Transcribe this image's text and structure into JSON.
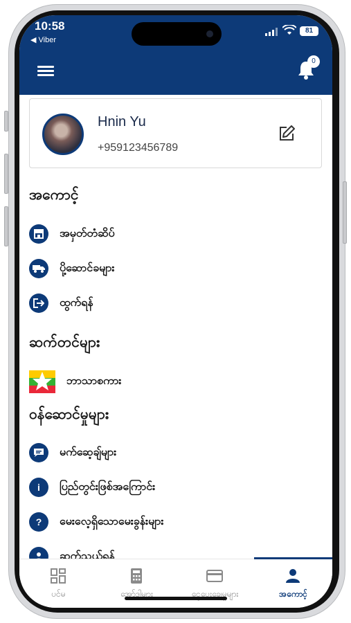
{
  "status_bar": {
    "time": "10:58",
    "back_app": "◀ Viber",
    "battery": "81"
  },
  "header": {
    "menu_icon": "hamburger-icon",
    "notification_icon": "bell-icon",
    "notification_count": "0"
  },
  "profile": {
    "name": "Hnin Yu",
    "phone": "+959123456789",
    "edit_icon": "edit-pencil-icon"
  },
  "sections": {
    "account": {
      "title": "အကောင့်",
      "items": [
        {
          "label": "အမှတ်တံဆိပ်",
          "icon": "store-icon"
        },
        {
          "label": "ပို့ဆောင်ခများ",
          "icon": "truck-icon"
        },
        {
          "label": "ထွက်ရန်",
          "icon": "logout-icon"
        }
      ]
    },
    "settings": {
      "title": "ဆက်တင်များ",
      "language": {
        "label": "ဘာသာစကား",
        "icon": "myanmar-flag-icon"
      }
    },
    "services": {
      "title": "ဝန်ဆောင်မှုများ",
      "items": [
        {
          "label": "မက်ဆေ့ချ်များ",
          "icon": "message-icon"
        },
        {
          "label": "ပြည်တွင်းဖြစ်အကြောင်း",
          "icon": "info-icon"
        },
        {
          "label": "မေးလေ့ရှိသောမေးခွန်းများ",
          "icon": "question-icon"
        },
        {
          "label": "ဆက်သွယ်ရန်",
          "icon": "contact-icon"
        }
      ]
    }
  },
  "bottom_nav": {
    "tabs": [
      {
        "label": "ပင်မ",
        "icon": "grid-icon"
      },
      {
        "label": "အော်ဒါများ",
        "icon": "calculator-icon"
      },
      {
        "label": "ငွေပေးချေမှုများ",
        "icon": "card-icon"
      },
      {
        "label": "အကောင့်",
        "icon": "person-icon",
        "active": true
      }
    ]
  },
  "colors": {
    "primary": "#0d3a78",
    "inactive_tab": "#8a8a8a"
  }
}
